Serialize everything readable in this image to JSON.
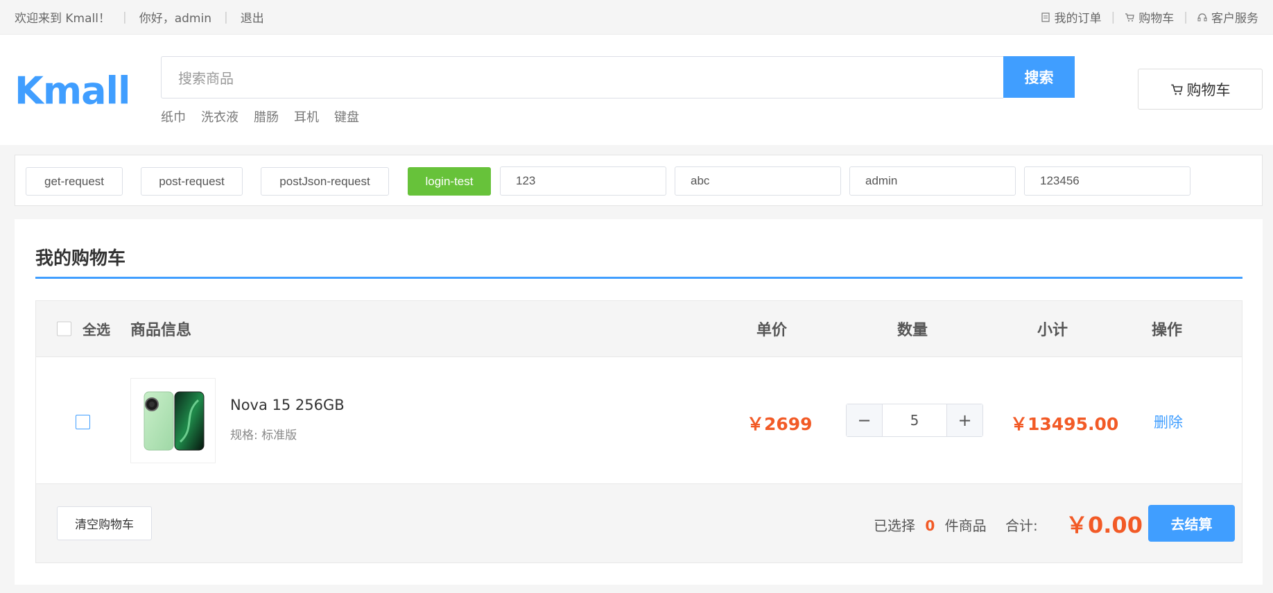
{
  "topbar": {
    "welcome": "欢迎来到 Kmall！",
    "greeting": "你好，admin",
    "logout": "退出",
    "orders": "我的订单",
    "cart": "购物车",
    "service": "客户服务"
  },
  "header": {
    "logo": "Kmall",
    "search_placeholder": "搜索商品",
    "search_button": "搜索",
    "hot_words": [
      "纸巾",
      "洗衣液",
      "腊肠",
      "耳机",
      "键盘"
    ],
    "cart_button": "购物车"
  },
  "testbar": {
    "buttons": [
      "get-request",
      "post-request",
      "postJson-request",
      "login-test"
    ],
    "inputs": [
      "123",
      "abc",
      "admin",
      "123456"
    ]
  },
  "cart": {
    "title": "我的购物车",
    "columns": {
      "select_all": "全选",
      "product_info": "商品信息",
      "unit_price": "单价",
      "quantity": "数量",
      "subtotal": "小计",
      "action": "操作"
    },
    "items": [
      {
        "name": "Nova 15 256GB",
        "spec": "规格: 标准版",
        "unit_price": "￥2699",
        "quantity": "5",
        "subtotal": "￥13495.00",
        "action": "删除"
      }
    ],
    "qty_minus": "−",
    "qty_plus": "+",
    "footer": {
      "clear_button": "清空购物车",
      "selected_prefix": "已选择",
      "selected_count": "0",
      "selected_suffix": "件商品",
      "total_label": "合计:",
      "total_value": "￥0.00",
      "checkout_button": "去结算"
    }
  },
  "colors": {
    "accent": "#409eff",
    "price": "#f25a26",
    "login_button": "#67c23a"
  }
}
